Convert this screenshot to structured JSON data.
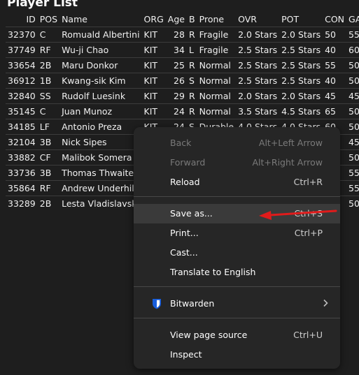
{
  "page": {
    "title": "Player List"
  },
  "table": {
    "columns": [
      "ID",
      "POS",
      "Name",
      "ORG",
      "Age",
      "B",
      "Prone",
      "OVR",
      "POT",
      "CON",
      "GA"
    ],
    "rows": [
      [
        "32370",
        "C",
        "Romuald Albertini",
        "KIT",
        "28",
        "R",
        "Fragile",
        "2.0 Stars",
        "2.0 Stars",
        "50",
        "55"
      ],
      [
        "37749",
        "RF",
        "Wu-ji Chao",
        "KIT",
        "34",
        "L",
        "Fragile",
        "2.5 Stars",
        "2.5 Stars",
        "40",
        "60"
      ],
      [
        "33654",
        "2B",
        "Maru Donkor",
        "KIT",
        "25",
        "R",
        "Normal",
        "2.5 Stars",
        "2.5 Stars",
        "55",
        "50"
      ],
      [
        "36912",
        "1B",
        "Kwang-sik Kim",
        "KIT",
        "26",
        "S",
        "Normal",
        "2.5 Stars",
        "2.5 Stars",
        "40",
        "50"
      ],
      [
        "32840",
        "SS",
        "Rudolf Luesink",
        "KIT",
        "29",
        "R",
        "Normal",
        "2.0 Stars",
        "2.0 Stars",
        "45",
        "45"
      ],
      [
        "35145",
        "C",
        "Juan Munoz",
        "KIT",
        "24",
        "R",
        "Normal",
        "3.5 Stars",
        "4.5 Stars",
        "65",
        "50"
      ],
      [
        "34185",
        "LF",
        "Antonio Preza",
        "KIT",
        "24",
        "S",
        "Durable",
        "4.0 Stars",
        "4.0 Stars",
        "60",
        "50"
      ],
      [
        "32104",
        "3B",
        "Nick Sipes",
        "",
        "",
        "",
        "",
        "",
        "",
        "",
        "45"
      ],
      [
        "33882",
        "CF",
        "Malibok Somera",
        "",
        "",
        "",
        "",
        "",
        "",
        "",
        "50"
      ],
      [
        "33736",
        "3B",
        "Thomas Thwaites",
        "",
        "",
        "",
        "",
        "",
        "",
        "",
        "55"
      ],
      [
        "35864",
        "RF",
        "Andrew Underhill",
        "",
        "",
        "",
        "",
        "",
        "",
        "",
        "55"
      ],
      [
        "33289",
        "2B",
        "Lesta Vladislavski",
        "",
        "",
        "",
        "",
        "",
        "",
        "",
        "50"
      ]
    ]
  },
  "context_menu": {
    "back": {
      "label": "Back",
      "shortcut": "Alt+Left Arrow"
    },
    "forward": {
      "label": "Forward",
      "shortcut": "Alt+Right Arrow"
    },
    "reload": {
      "label": "Reload",
      "shortcut": "Ctrl+R"
    },
    "save_as": {
      "label": "Save as...",
      "shortcut": "Ctrl+S"
    },
    "print": {
      "label": "Print...",
      "shortcut": "Ctrl+P"
    },
    "cast": {
      "label": "Cast..."
    },
    "translate": {
      "label": "Translate to English"
    },
    "bitwarden": {
      "label": "Bitwarden",
      "icon": "bitwarden-shield-icon"
    },
    "view_source": {
      "label": "View page source",
      "shortcut": "Ctrl+U"
    },
    "inspect": {
      "label": "Inspect"
    }
  },
  "colors": {
    "page_bg": "#1e1e1e",
    "menu_bg": "#262626",
    "highlight": "#3a3a3a",
    "annotation_arrow": "#e01b1b",
    "bitwarden_blue": "#175ddc"
  }
}
